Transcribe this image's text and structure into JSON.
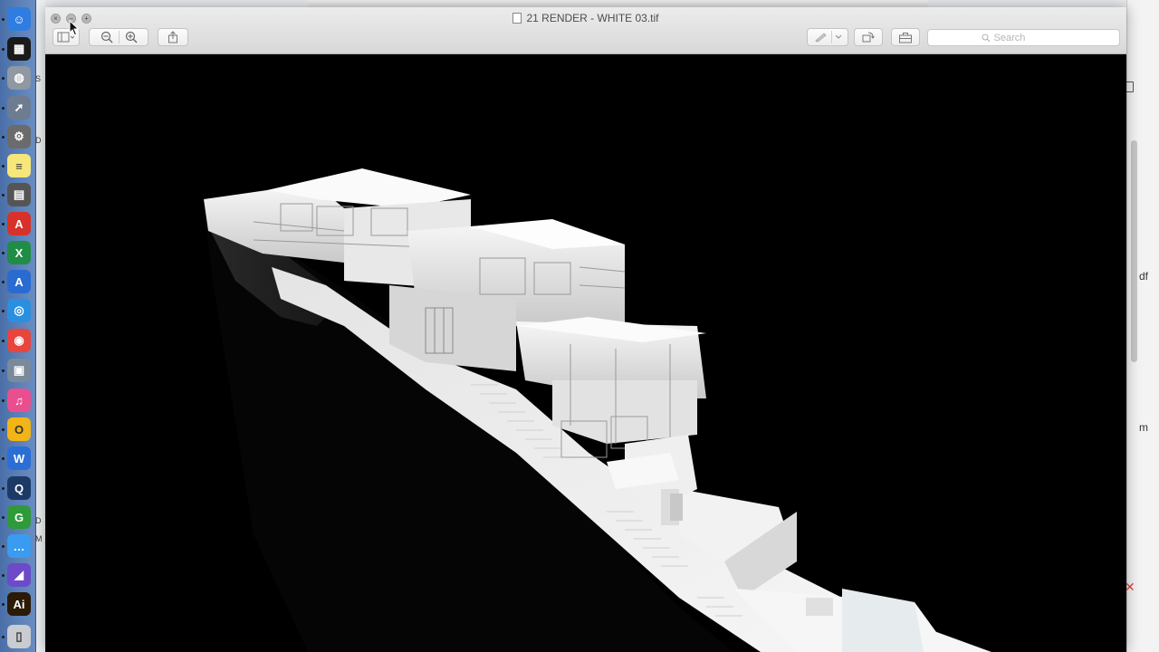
{
  "window": {
    "title": "21 RENDER - WHITE 03.tif",
    "close_glyph": "×",
    "minimize_glyph": "–",
    "zoom_glyph": "+"
  },
  "toolbar": {
    "sidebar_icon": "sidebar-icon",
    "zoom_out_icon": "zoom-out-icon",
    "zoom_in_icon": "zoom-in-icon",
    "share_icon": "share-icon",
    "markup_icon": "pen-icon",
    "rotate_icon": "rotate-icon",
    "toolbox_icon": "toolbox-icon",
    "search_placeholder": "Search",
    "search_value": ""
  },
  "peek": {
    "right_1": "df",
    "right_2": "m"
  },
  "dock": {
    "items": [
      {
        "name": "finder",
        "color": "#2f7de1",
        "glyph": "☺"
      },
      {
        "name": "mission-control",
        "color": "#1a1a1a",
        "glyph": "▦"
      },
      {
        "name": "disk-utility",
        "color": "#8f98a3",
        "glyph": "◍"
      },
      {
        "name": "launchpad",
        "color": "#6e7c91",
        "glyph": "➚"
      },
      {
        "name": "system-preferences",
        "color": "#6b6b6b",
        "glyph": "⚙"
      },
      {
        "name": "notes",
        "color": "#f7e67a",
        "glyph": "≡"
      },
      {
        "name": "calculator",
        "color": "#555555",
        "glyph": "▤"
      },
      {
        "name": "acrobat",
        "color": "#d8312a",
        "glyph": "A"
      },
      {
        "name": "excel",
        "color": "#1f8d45",
        "glyph": "X"
      },
      {
        "name": "archicad",
        "color": "#2a6bd1",
        "glyph": "A"
      },
      {
        "name": "safari",
        "color": "#2b8fe0",
        "glyph": "◎"
      },
      {
        "name": "chrome",
        "color": "#e8453c",
        "glyph": "◉"
      },
      {
        "name": "image-capture",
        "color": "#7a8a9a",
        "glyph": "▣"
      },
      {
        "name": "itunes",
        "color": "#e94f8e",
        "glyph": "♫"
      },
      {
        "name": "app-badge",
        "color": "#f2b416",
        "glyph": "O"
      },
      {
        "name": "word",
        "color": "#2b6ed6",
        "glyph": "W"
      },
      {
        "name": "quicktime",
        "color": "#1d3a66",
        "glyph": "Q"
      },
      {
        "name": "rhino",
        "color": "#2f9a3a",
        "glyph": "G"
      },
      {
        "name": "messages",
        "color": "#3a9cf0",
        "glyph": "…"
      },
      {
        "name": "cinema",
        "color": "#6c4ac9",
        "glyph": "◢"
      },
      {
        "name": "illustrator",
        "color": "#2b1a05",
        "glyph": "Ai"
      },
      {
        "name": "trash",
        "color": "#c9ccd0",
        "glyph": "▯"
      }
    ]
  },
  "colors": {
    "dock_bg": "#5a7eb6",
    "canvas_bg": "#000000",
    "render_white": "#f0f0f0",
    "render_shadow": "#9a9a9a"
  }
}
